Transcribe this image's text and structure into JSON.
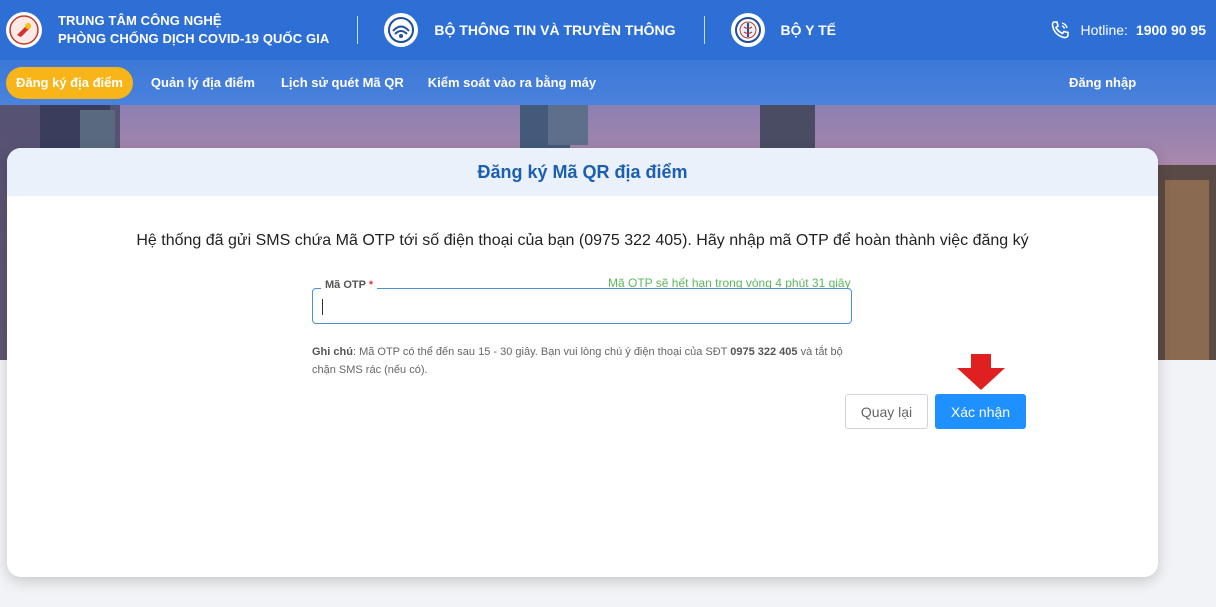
{
  "header": {
    "org_line1": "TRUNG TÂM CÔNG NGHỆ",
    "org_line2": "PHÒNG CHỐNG DỊCH COVID-19 QUỐC GIA",
    "partner1": "BỘ THÔNG TIN VÀ TRUYỀN THÔNG",
    "partner2": "BỘ Y TẾ",
    "hotline_label": "Hotline:",
    "hotline_number": "1900 90 95"
  },
  "nav": {
    "items": [
      {
        "label": "Đăng ký địa điểm"
      },
      {
        "label": "Quản lý địa điểm"
      },
      {
        "label": "Lịch sử quét Mã QR"
      },
      {
        "label": "Kiểm soát vào ra bằng máy"
      }
    ],
    "login": "Đăng nhập"
  },
  "card": {
    "title": "Đăng ký Mã QR địa điểm",
    "message": "Hệ thống đã gửi SMS chứa Mã OTP tới số điện thoại của bạn (0975 322 405). Hãy nhập mã OTP để hoàn thành việc đăng ký",
    "otp_label": "Mã OTP",
    "otp_required_mark": "*",
    "otp_expire": "Mã OTP sẽ hết hạn trong vòng 4 phút 31 giây",
    "otp_value": "",
    "note_prefix": "Ghi chú",
    "note_text1": ": Mã OTP có thể đến sau 15 - 30 giây. Bạn vui lòng chú ý điện thoại của SĐT ",
    "note_phone": "0975 322 405",
    "note_text2": " và tắt bộ chặn SMS rác (nếu có).",
    "back_button": "Quay lại",
    "confirm_button": "Xác nhận"
  },
  "colors": {
    "header_bg": "#2e6fd6",
    "nav_active": "#f7b519",
    "primary": "#1e90ff",
    "title": "#1b5fb0",
    "expire_text": "#5cb85c",
    "arrow": "#e02020"
  },
  "icons": [
    "covid-center-logo",
    "mic-logo",
    "moh-logo",
    "phone-icon",
    "down-arrow-icon"
  ]
}
